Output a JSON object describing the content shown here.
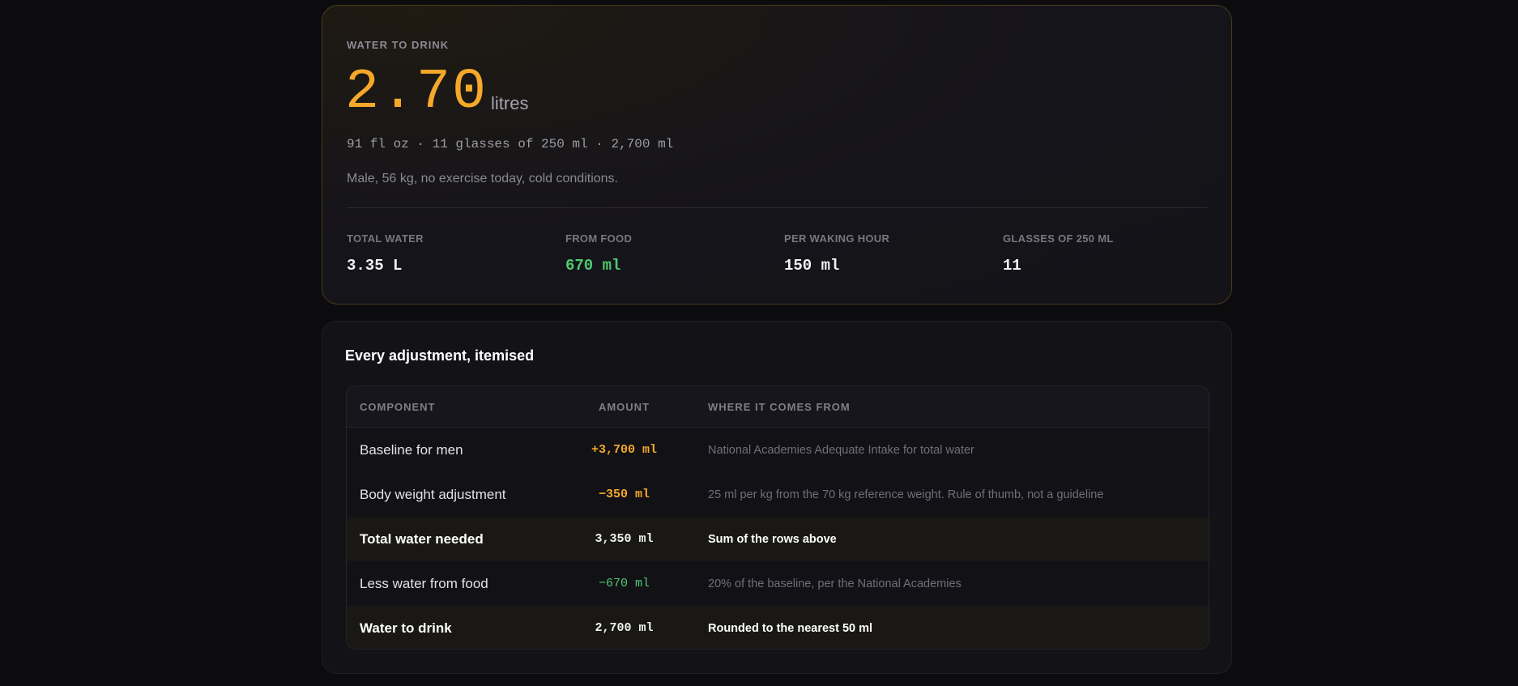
{
  "result": {
    "eyebrow": "WATER TO DRINK",
    "value": "2.70",
    "unit": "litres",
    "equivalents": "91 fl oz · 11 glasses of 250 ml · 2,700 ml",
    "profile": "Male, 56 kg, no exercise today, cold conditions.",
    "stats": [
      {
        "label": "TOTAL WATER",
        "value": "3.35 L"
      },
      {
        "label": "FROM FOOD",
        "value": "670 ml"
      },
      {
        "label": "PER WAKING HOUR",
        "value": "150 ml"
      },
      {
        "label": "GLASSES OF 250 ML",
        "value": "11"
      }
    ]
  },
  "breakdown": {
    "title": "Every adjustment, itemised",
    "headers": {
      "component": "COMPONENT",
      "amount": "AMOUNT",
      "source": "WHERE IT COMES FROM"
    },
    "rows": [
      {
        "component": "Baseline for men",
        "amount": "+3,700 ml",
        "source": "National Academies Adequate Intake for total water"
      },
      {
        "component": "Body weight adjustment",
        "amount": "−350 ml",
        "source": "25 ml per kg from the 70 kg reference weight. Rule of thumb, not a guideline"
      },
      {
        "component": "Total water needed",
        "amount": "3,350 ml",
        "source": "Sum of the rows above"
      },
      {
        "component": "Less water from food",
        "amount": "−670 ml",
        "source": "20% of the baseline, per the National Academies"
      },
      {
        "component": "Water to drink",
        "amount": "2,700 ml",
        "source": "Rounded to the nearest 50 ml"
      }
    ]
  },
  "colors": {
    "accent": "#f5a82a",
    "positive": "#4ecb71",
    "background": "#0c0c0e",
    "card": "#121217"
  }
}
